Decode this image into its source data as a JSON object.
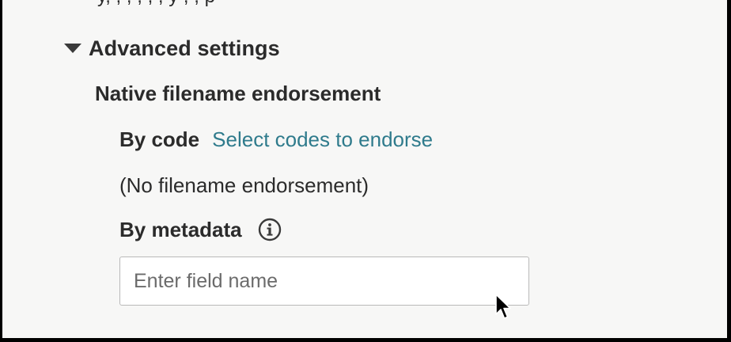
{
  "cut_off_text": "y,   ,          ,              ,    ,   ,        y   ,   ,   p",
  "advanced": {
    "title": "Advanced settings",
    "expanded": true
  },
  "native": {
    "title": "Native filename endorsement",
    "by_code_label": "By code",
    "select_codes_link": "Select codes to endorse",
    "no_endorsement_text": "(No filename endorsement)",
    "by_metadata_label": "By metadata",
    "field_placeholder": "Enter field name",
    "field_value": ""
  },
  "icons": {
    "caret": "caret-down-icon",
    "info": "info-icon",
    "pointer": "mouse-pointer-icon"
  },
  "colors": {
    "background": "#f7f7f6",
    "link": "#2f7b8c",
    "text": "#2b2b2b",
    "border": "#b9b9b9"
  }
}
